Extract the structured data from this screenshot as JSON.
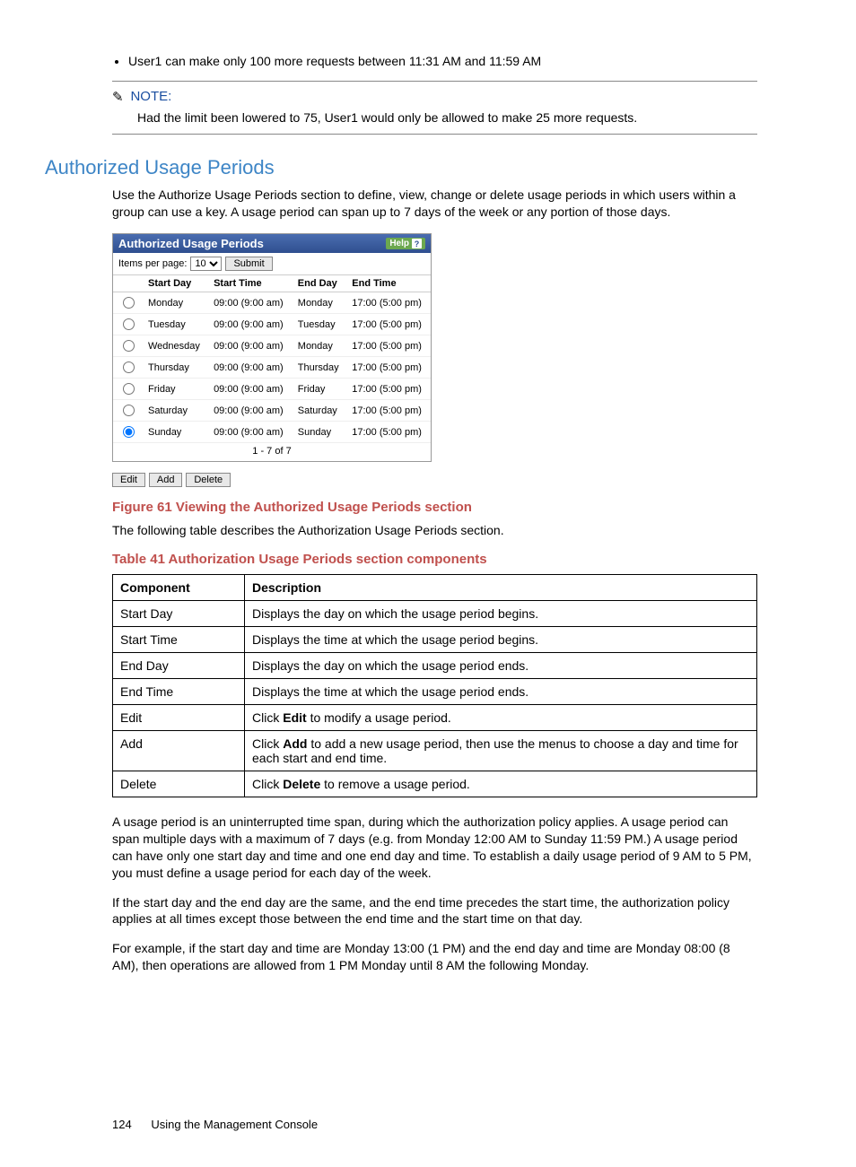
{
  "bullet": "User1 can make only 100 more requests between 11:31 AM and 11:59 AM",
  "note": {
    "label": "NOTE:",
    "body": "Had the limit been lowered to 75, User1 would only be allowed to make 25 more requests."
  },
  "section_heading": "Authorized Usage Periods",
  "intro": "Use the Authorize Usage Periods section to define, view, change or delete usage periods in which users within a group can use a key. A usage period can span up to 7 days of the week or any portion of those days.",
  "widget": {
    "title": "Authorized Usage Periods",
    "help": "Help",
    "items_label": "Items per page:",
    "items_value": "10",
    "submit": "Submit",
    "headers": {
      "c0": "Start Day",
      "c1": "Start Time",
      "c2": "End Day",
      "c3": "End Time"
    },
    "rows": [
      {
        "sd": "Monday",
        "st": "09:00 (9:00 am)",
        "ed": "Monday",
        "et": "17:00 (5:00 pm)",
        "sel": false
      },
      {
        "sd": "Tuesday",
        "st": "09:00 (9:00 am)",
        "ed": "Tuesday",
        "et": "17:00 (5:00 pm)",
        "sel": false
      },
      {
        "sd": "Wednesday",
        "st": "09:00 (9:00 am)",
        "ed": "Monday",
        "et": "17:00 (5:00 pm)",
        "sel": false
      },
      {
        "sd": "Thursday",
        "st": "09:00 (9:00 am)",
        "ed": "Thursday",
        "et": "17:00 (5:00 pm)",
        "sel": false
      },
      {
        "sd": "Friday",
        "st": "09:00 (9:00 am)",
        "ed": "Friday",
        "et": "17:00 (5:00 pm)",
        "sel": false
      },
      {
        "sd": "Saturday",
        "st": "09:00 (9:00 am)",
        "ed": "Saturday",
        "et": "17:00 (5:00 pm)",
        "sel": false
      },
      {
        "sd": "Sunday",
        "st": "09:00 (9:00 am)",
        "ed": "Sunday",
        "et": "17:00 (5:00 pm)",
        "sel": true
      }
    ],
    "pager": "1 - 7 of 7",
    "edit": "Edit",
    "add": "Add",
    "delete": "Delete"
  },
  "figure_caption": "Figure 61 Viewing the Authorized Usage Periods section",
  "following": "The following table describes the Authorization Usage Periods section.",
  "table_caption": "Table 41 Authorization Usage Periods section components",
  "desc_headers": {
    "c0": "Component",
    "c1": "Description"
  },
  "desc_rows": [
    {
      "c": "Start Day",
      "d": "Displays the day on which the usage period begins."
    },
    {
      "c": "Start Time",
      "d": "Displays the time at which the usage period begins."
    },
    {
      "c": "End Day",
      "d": "Displays the day on which the usage period ends."
    },
    {
      "c": "End Time",
      "d": "Displays the time at which the usage period ends."
    },
    {
      "c": "Edit",
      "d_pre": "Click ",
      "d_b": "Edit",
      "d_post": " to modify a usage period."
    },
    {
      "c": "Add",
      "d_pre": "Click ",
      "d_b": "Add",
      "d_post": " to add a new usage period, then use the menus to choose a day and time for each start and end time."
    },
    {
      "c": "Delete",
      "d_pre": "Click ",
      "d_b": "Delete",
      "d_post": " to remove a usage period."
    }
  ],
  "p1": "A usage period is an uninterrupted time span, during which the authorization policy applies. A usage period can span multiple days with a maximum of 7 days (e.g. from Monday 12:00 AM to Sunday 11:59 PM.) A usage period can have only one start day and time and one end day and time. To establish a daily usage period of 9 AM to 5 PM, you must define a usage period for each day of the week.",
  "p2": "If the start day and the end day are the same, and the end time precedes the start time, the authorization policy applies at all times except those between the end time and the start time on that day.",
  "p3": "For example, if the start day and time are Monday 13:00 (1 PM) and the end day and time are Monday 08:00 (8 AM), then operations are allowed from 1 PM Monday until 8 AM the following Monday.",
  "footer": {
    "page": "124",
    "title": "Using the Management Console"
  }
}
